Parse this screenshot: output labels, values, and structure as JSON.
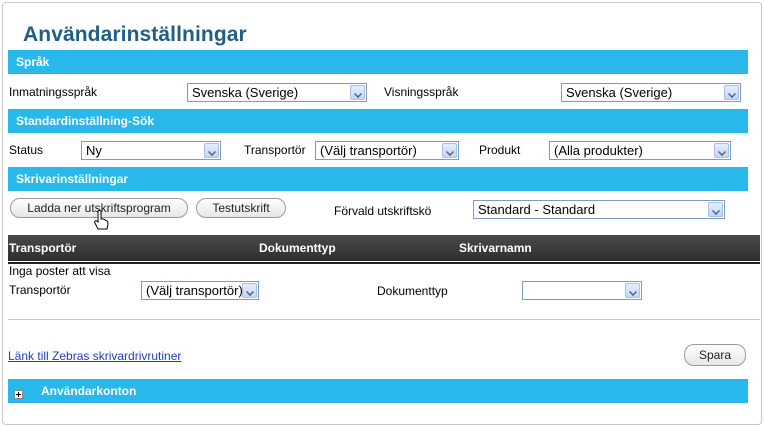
{
  "page": {
    "title": "Användarinställningar"
  },
  "sections": {
    "language": "Språk",
    "search_defaults": "Standardinställning-Sök",
    "printer": "Skrivarinställningar",
    "accounts": "Användarkonton"
  },
  "language": {
    "input_label": "Inmatningsspråk",
    "input_value": "Svenska (Sverige)",
    "display_label": "Visningsspråk",
    "display_value": "Svenska (Sverige)"
  },
  "search": {
    "status_label": "Status",
    "status_value": "Ny",
    "carrier_label": "Transportör",
    "carrier_value": "(Välj transportör)",
    "product_label": "Produkt",
    "product_value": "(Alla produkter)"
  },
  "printer": {
    "download_button": "Ladda ner utskriftsprogram",
    "test_button": "Testutskrift",
    "queue_label": "Förvald utskriftskö",
    "queue_value": "Standard - Standard"
  },
  "table": {
    "columns": [
      "Transportör",
      "Dokumenttyp",
      "Skrivarnamn"
    ],
    "empty_text": "Inga poster att visa"
  },
  "add_row": {
    "carrier_label": "Transportör",
    "carrier_value": "(Välj transportör)",
    "doctype_label": "Dokumenttyp",
    "doctype_value": ""
  },
  "footer": {
    "zebra_link": "Länk till Zebras skrivardrivrutiner",
    "save_button": "Spara"
  },
  "colors": {
    "band": "#29b8ec",
    "title": "#1f5f86",
    "link": "#1a3fbf"
  }
}
